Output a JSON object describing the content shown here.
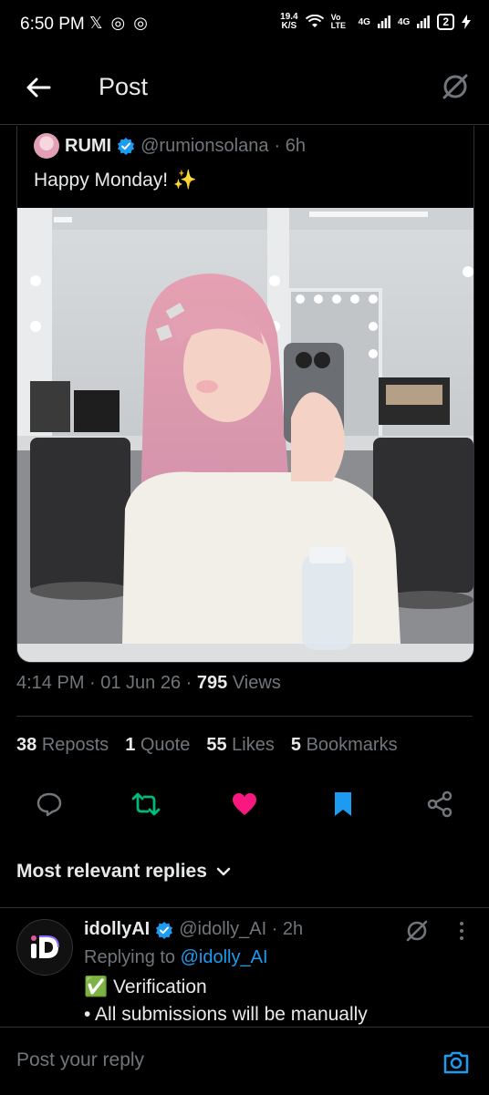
{
  "status_bar": {
    "time": "6:50 PM",
    "app_icons": "𝕏 ◎ ◎",
    "speed_top": "19.4",
    "speed_unit": "K/S",
    "volte": "Vo LTE",
    "net1": "4G",
    "net2": "4G",
    "battery": "2"
  },
  "header": {
    "title": "Post",
    "back_icon": "arrow-left-icon",
    "grok_icon": "grok-icon"
  },
  "quoted_post": {
    "author_name": "RUMI",
    "handle": "@rumionsolana",
    "time_ago": "· 6h",
    "text": "Happy Monday! ✨"
  },
  "post_meta": {
    "time": "4:14 PM · 01 Jun 26 ·",
    "views_count": "795",
    "views_label": "Views"
  },
  "stats": {
    "reposts_count": "38",
    "reposts_label": "Reposts",
    "quote_count": "1",
    "quote_label": "Quote",
    "likes_count": "55",
    "likes_label": "Likes",
    "bookmarks_count": "5",
    "bookmarks_label": "Bookmarks"
  },
  "actions": {
    "reply_icon": "comment-icon",
    "repost_icon": "repost-icon",
    "like_icon": "heart-icon",
    "bookmark_icon": "bookmark-icon",
    "share_icon": "share-icon",
    "like_color": "#f91880",
    "repost_color": "#00ba7c",
    "bookmark_color": "#1d9bf0"
  },
  "replies_filter": {
    "label": "Most relevant replies"
  },
  "reply": {
    "name": "idollyAI",
    "handle": "@idolly_AI · 2h",
    "replying_prefix": "Replying to",
    "replying_to": "@idolly_AI",
    "line1": "✅ Verification",
    "line2": "• All submissions will be manually"
  },
  "reply_bar": {
    "placeholder": "Post your reply"
  },
  "colors": {
    "accent": "#1d9bf0",
    "background": "#000000",
    "muted": "#71767b"
  }
}
